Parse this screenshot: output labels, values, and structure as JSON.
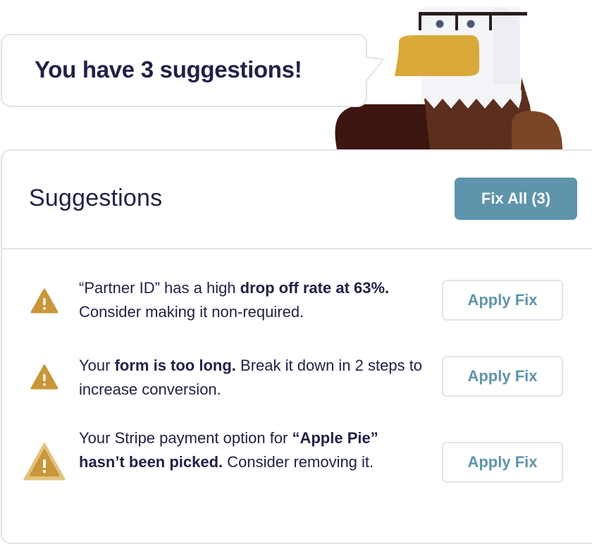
{
  "bubble": {
    "text": "You have 3 suggestions!"
  },
  "panel": {
    "title": "Suggestions",
    "fix_all_label": "Fix All (3)"
  },
  "suggestions": [
    {
      "pre": "“Partner ID” has a high ",
      "bold": "drop off rate at 63%.",
      "post": " Consider making it non-required.",
      "action": "Apply Fix"
    },
    {
      "pre": "Your ",
      "bold": "form is too long.",
      "post": " Break it down in 2 steps to increase conversion.",
      "action": "Apply Fix"
    },
    {
      "pre": "Your Stripe payment option for ",
      "bold": "“Apple Pie” hasn’t been picked.",
      "post": " Consider removing it.",
      "action": "Apply Fix"
    }
  ],
  "icons": {
    "warning": "warning-triangle-icon",
    "mascot": "eagle-mascot"
  },
  "colors": {
    "accent": "#5e94ac",
    "warning": "#c9963a",
    "text": "#1f2147",
    "border": "#e2e4ec"
  }
}
